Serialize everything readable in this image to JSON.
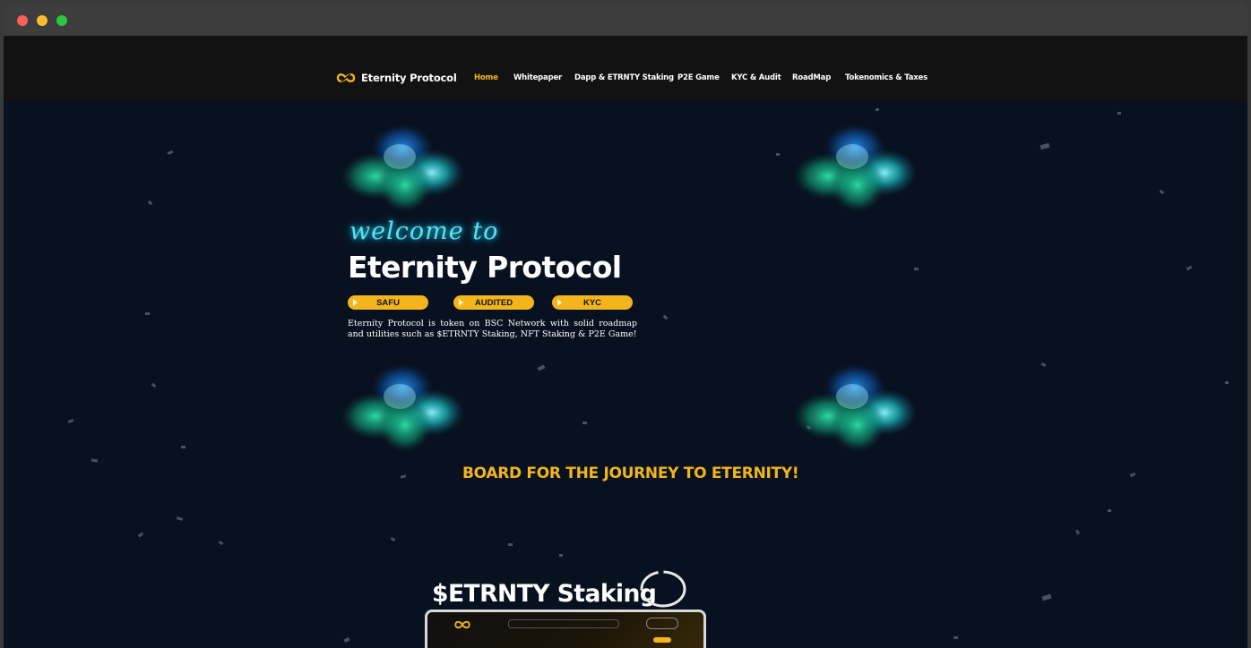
{
  "brand": {
    "name": "Eternity Protocol",
    "icon": "infinity-logo-icon"
  },
  "nav": {
    "items": [
      {
        "label": "Home",
        "active": true
      },
      {
        "label": "Whitepaper",
        "active": false
      },
      {
        "label": "Dapp & ETRNTY Staking",
        "active": false
      },
      {
        "label": "P2E Game",
        "active": false
      },
      {
        "label": "KYC & Audit",
        "active": false
      },
      {
        "label": "RoadMap",
        "active": false
      },
      {
        "label": "Tokenomics & Taxes",
        "active": false
      }
    ]
  },
  "hero": {
    "welcome": "welcome to",
    "title": "Eternity Protocol",
    "badges": [
      "SAFU",
      "AUDITED",
      "KYC"
    ],
    "description": "Eternity Protocol is token on BSC Network with solid roadmap and utilities such as $ETRNTY Staking, NFT Staking & P2E Game!"
  },
  "journey": {
    "text": "BOARD FOR THE JOURNEY TO ETERNITY!"
  },
  "staking": {
    "title": "$ETRNTY Staking"
  },
  "colors": {
    "accent": "#f3b51b",
    "background": "#081120",
    "navbar": "#121212",
    "glow": "#5ce0f0"
  }
}
